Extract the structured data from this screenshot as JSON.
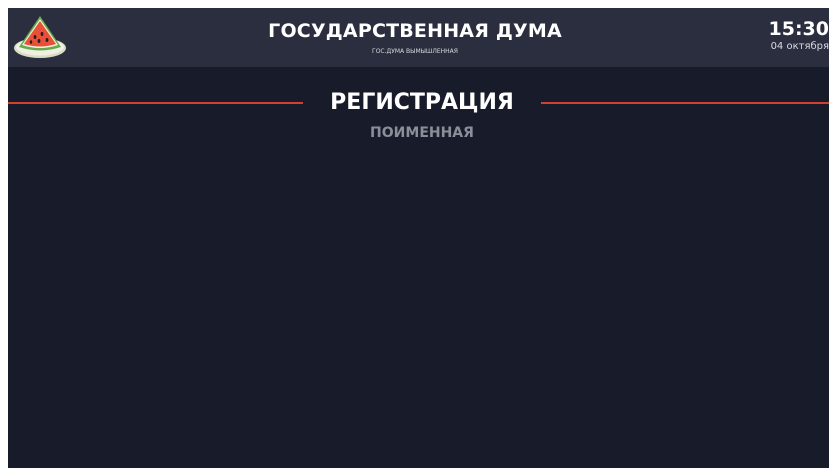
{
  "header": {
    "logo_icon": "watermelon-icon",
    "title": "ГОСУДАРСТВЕННАЯ ДУМА",
    "subtitle": "ГОС.ДУМА ВЫМЫШЛЕННАЯ",
    "time": "15:30",
    "date": "04 октября"
  },
  "main": {
    "title": "РЕГИСТРАЦИЯ",
    "subtitle": "ПОИМЕННАЯ"
  },
  "colors": {
    "background": "#181c2a",
    "header_background": "#2a2e3e",
    "accent_rule": "#d2402f",
    "subtitle_text": "#8b8e99"
  }
}
